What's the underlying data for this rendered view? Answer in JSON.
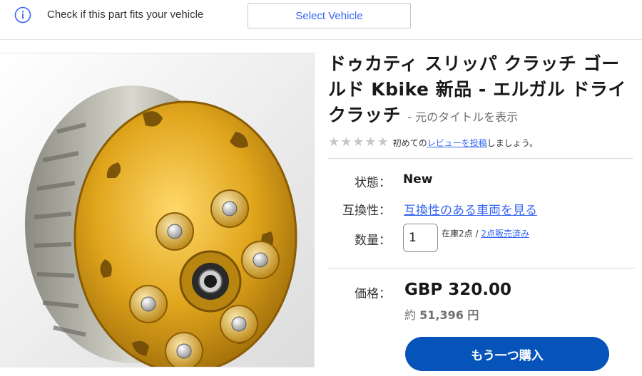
{
  "fitment": {
    "icon": "info-icon",
    "text": "Check if this part fits your vehicle",
    "button_label": "Select Vehicle"
  },
  "product": {
    "image_alt": "clutch",
    "title": "ドゥカティ スリッパ クラッチ ゴールド Kbike 新品 - エルガル ドライ クラッチ",
    "original_title_link": "- 元のタイトルを表示"
  },
  "reviews": {
    "stars_filled": 0,
    "stars_total": 5,
    "prefix": "初めての",
    "link": "レビューを投稿",
    "suffix": "しましょう。"
  },
  "details": {
    "condition_label": "状態：",
    "condition_value": "New",
    "compat_label": "互換性：",
    "compat_link": "互換性のある車両を見る",
    "qty_label": "数量：",
    "qty_value": "1",
    "stock_text": "在庫2点 /",
    "sold_link": "2点販売済み"
  },
  "pricing": {
    "price_label": "価格：",
    "price": "GBP 320.00",
    "approx_prefix": "約",
    "approx_value": "51,396 円",
    "buy_button": "もう一つ購入"
  },
  "colors": {
    "link": "#3665f3",
    "buy_button": "#0654ba",
    "gold": "#d9a21b"
  }
}
